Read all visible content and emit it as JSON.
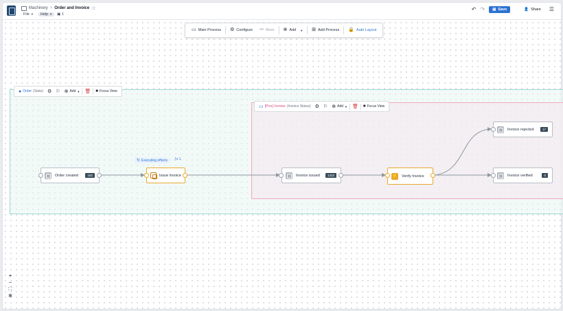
{
  "header": {
    "breadcrumb_parent": "Machinery",
    "breadcrumb_sep": ">",
    "title": "Order and Invoice",
    "menus": [
      {
        "label": "File"
      },
      {
        "label": "Help"
      }
    ],
    "users_count": "1",
    "save_label": "Save",
    "share_label": "Share"
  },
  "toolbar": {
    "main_process": "Main Process",
    "configure": "Configure",
    "more": "More",
    "add": "Add",
    "add_process": "Add Process",
    "auto_layout": "Auto Layout"
  },
  "groups": {
    "order": {
      "name": "Order",
      "sub": "(State)",
      "add": "Add",
      "focus": "Focus View"
    },
    "invoice": {
      "name": "[Proc] Invoice",
      "sub": "(Invoice Status)",
      "add": "Add",
      "focus": "Focus View"
    }
  },
  "nodes": {
    "order_created": {
      "label": "Order created",
      "count": "182"
    },
    "issue_invoice": {
      "label": "Issue Invoice"
    },
    "invoice_issued": {
      "label": "Invoice issued",
      "count": "1323"
    },
    "verify_invoice": {
      "label": "Verify Invoice"
    },
    "invoice_rejected": {
      "label": "Invoice rejected",
      "count": "17"
    },
    "invoice_verified": {
      "label": "Invoice verified",
      "count": "0"
    }
  },
  "effects": {
    "label": "Executing effects",
    "fx_count": "1"
  },
  "colors": {
    "accent": "#2d72d2",
    "order_group": "#9fd9cf",
    "invoice_group": "#f0a6bd",
    "action_node": "#e8a92e"
  },
  "icons": [
    "app-icon",
    "star-icon",
    "undo-icon",
    "redo-icon",
    "save-icon",
    "share-icon",
    "menu-icon",
    "process-icon",
    "gear-icon",
    "more-icon",
    "add-icon",
    "lock-icon",
    "trash-icon",
    "focus-icon",
    "bolt-icon",
    "zoom-in-icon",
    "zoom-out-icon",
    "fit-icon",
    "settings-icon"
  ]
}
